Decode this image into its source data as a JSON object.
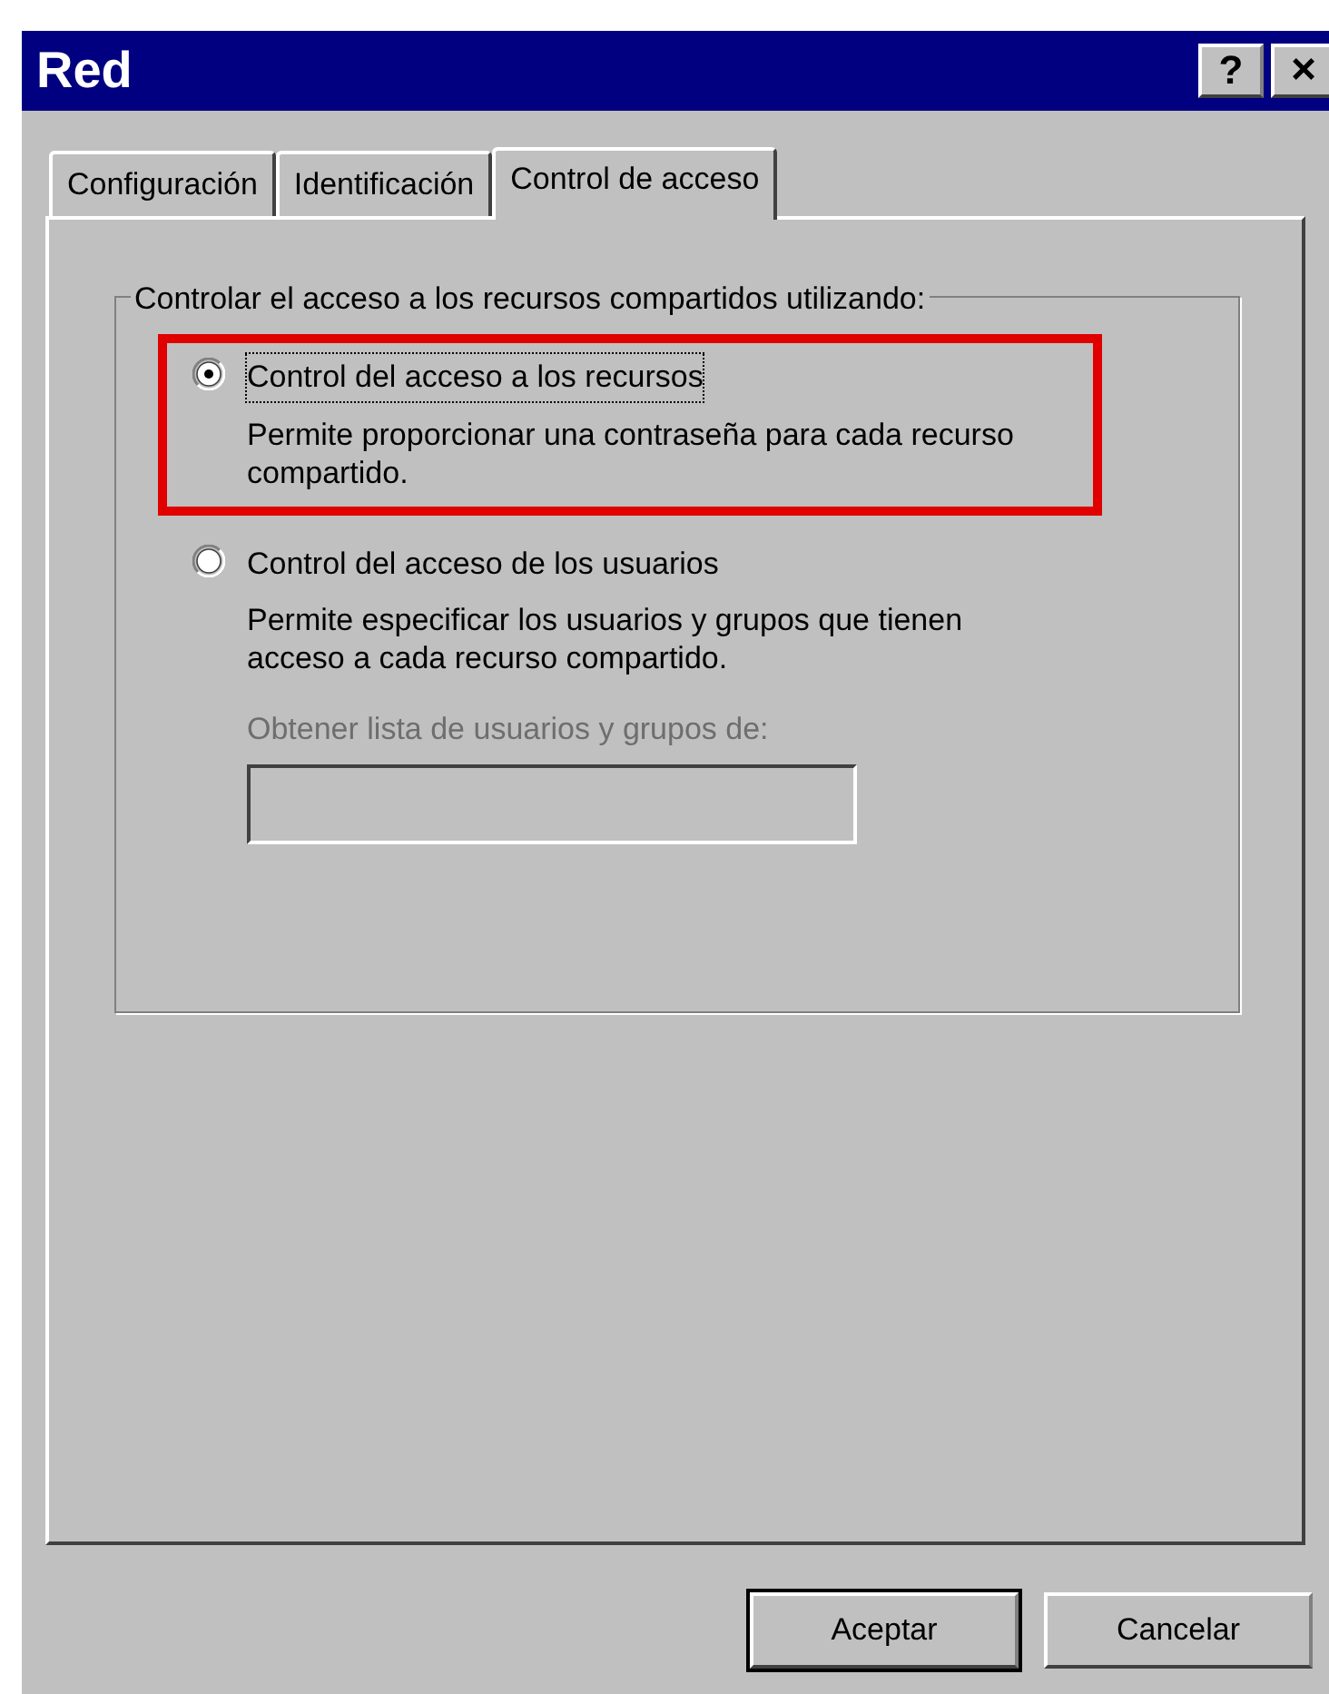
{
  "window": {
    "title": "Red",
    "help_button": "?",
    "close_button": "×"
  },
  "tabs": [
    {
      "label": "Configuración",
      "selected": false
    },
    {
      "label": "Identificación",
      "selected": false
    },
    {
      "label": "Control de acceso",
      "selected": true
    }
  ],
  "group": {
    "title": "Controlar el acceso a los recursos compartidos utilizando:",
    "options": [
      {
        "label": "Control del acceso a los recursos",
        "description": "Permite proporcionar una contraseña para cada recurso compartido.",
        "selected": true,
        "highlighted": true
      },
      {
        "label": "Control del acceso de los usuarios",
        "description": "Permite especificar los usuarios y grupos que tienen acceso a cada recurso compartido.",
        "selected": false,
        "highlighted": false
      }
    ],
    "source_label": {
      "text": "Obtener lista de usuarios y grupos de:",
      "disabled": true
    },
    "source_field": {
      "disabled": true
    }
  },
  "buttons": [
    {
      "label": "Aceptar",
      "default": true
    },
    {
      "label": "Cancelar",
      "default": false
    }
  ]
}
